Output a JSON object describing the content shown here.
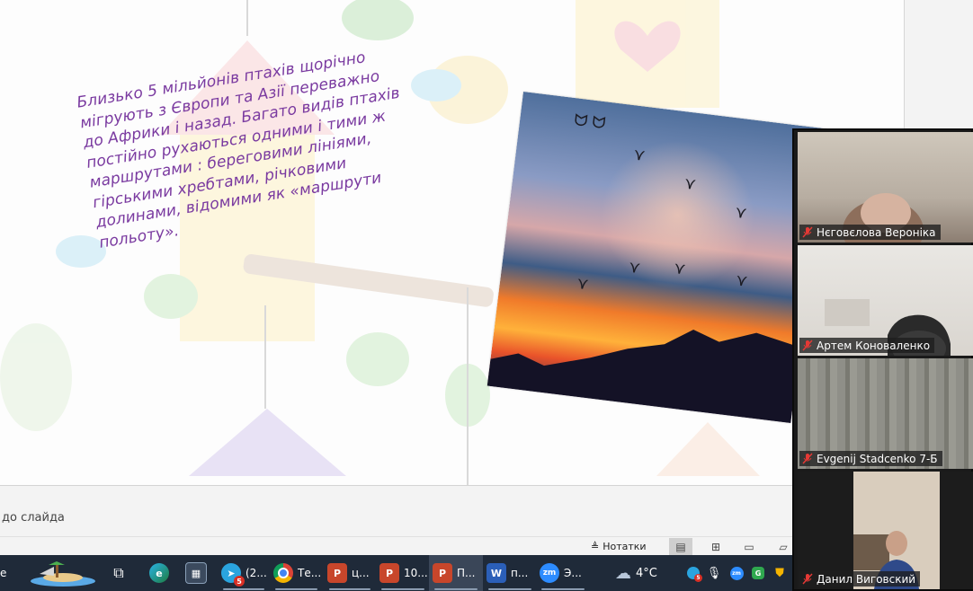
{
  "slide": {
    "text": "Близько 5 мільйонів птахів щорічно мігрують з Європи та Азії переважно до Африки і назад. Багато видів птахів постійно рухаються одними і тими ж маршрутами : береговими лініями, гірськими хребтами, річковими долинами, відомими як «маршрути польоту».",
    "photo_icon": "birds-sunset-photo"
  },
  "notes": {
    "placeholder": "до слайда"
  },
  "status_bar": {
    "notes_label": "Нотатки",
    "view_icons": [
      "normal-view-icon",
      "slide-sorter-icon",
      "reading-view-icon",
      "slideshow-icon"
    ]
  },
  "taskbar": {
    "left_cut_text": "е",
    "items": [
      {
        "name": "task-view",
        "icon": "task-view-icon",
        "label": ""
      },
      {
        "name": "edge",
        "icon": "edge-icon",
        "label": ""
      },
      {
        "name": "calculator",
        "icon": "calculator-icon",
        "label": ""
      },
      {
        "name": "telegram",
        "icon": "telegram-icon",
        "label": "(2...",
        "badge": "5"
      },
      {
        "name": "chrome",
        "icon": "chrome-icon",
        "label": "Те..."
      },
      {
        "name": "powerpoint-1",
        "icon": "powerpoint-icon",
        "label": "ц..."
      },
      {
        "name": "powerpoint-2",
        "icon": "powerpoint-icon",
        "label": "10..."
      },
      {
        "name": "powerpoint-3",
        "icon": "powerpoint-icon",
        "label": "П..."
      },
      {
        "name": "word",
        "icon": "word-icon",
        "label": "п..."
      },
      {
        "name": "zoom",
        "icon": "zoom-icon",
        "label": "Э..."
      }
    ],
    "weather": "4°C",
    "tray_badge": "5"
  },
  "participants": [
    {
      "name": "Нєговєлова Вероніка",
      "muted": true
    },
    {
      "name": "Артем Коноваленко",
      "muted": true
    },
    {
      "name": "Evgenij Stadcenko 7-Б",
      "muted": true
    },
    {
      "name": "Данил Виговский",
      "muted": true
    }
  ],
  "colors": {
    "slide_text": "#7a3aa0",
    "taskbar": "#1f2a39",
    "mute_red": "#e53935"
  }
}
